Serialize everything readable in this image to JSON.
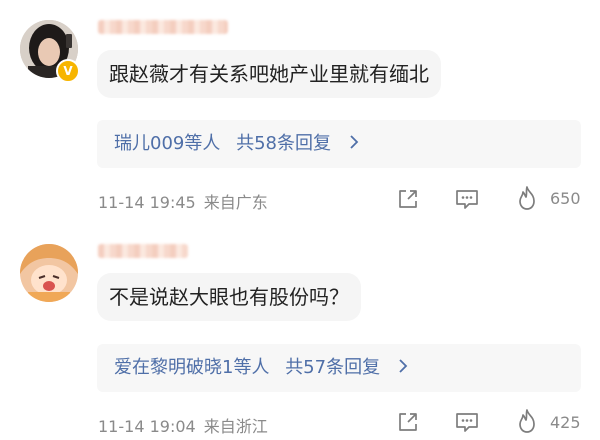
{
  "comments": [
    {
      "text": "跟赵薇才有关系吧她产业里就有缅北",
      "reply_summary": {
        "users": "瑞儿009等人",
        "count_label": "共58条回复"
      },
      "time": "11-14 19:45",
      "location": "来自广东",
      "likes": "650",
      "verified_badge": "V"
    },
    {
      "text": "不是说赵大眼也有股份吗？",
      "reply_summary": {
        "users": "爱在黎明破晓1等人",
        "count_label": "共57条回复"
      },
      "time": "11-14 19:04",
      "location": "来自浙江",
      "likes": "425"
    }
  ],
  "icons": {
    "share": "share-icon",
    "comment": "comment-icon",
    "like": "like-icon",
    "chevron": "chevron-right-icon"
  },
  "colors": {
    "link_blue": "#4f6fa8",
    "meta_gray": "#8a8a8a",
    "bubble_bg": "#f5f5f5",
    "badge_gold": "#f7b500"
  }
}
